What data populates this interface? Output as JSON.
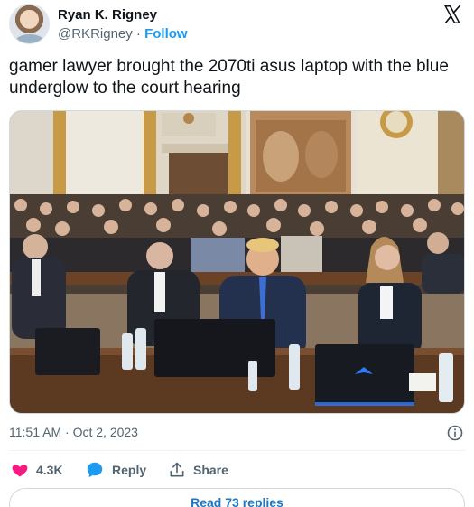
{
  "author": {
    "name": "Ryan K. Rigney",
    "handle": "@RKRigney",
    "separator": " · ",
    "follow_label": "Follow"
  },
  "brand": {
    "icon": "x-logo-icon"
  },
  "tweet": {
    "text": "gamer lawyer brought the 2070ti asus laptop with the blue underglow to the court hearing"
  },
  "media": {
    "type": "photo",
    "icon": "courtroom-photo"
  },
  "meta": {
    "time": "11:51 AM",
    "dot": " · ",
    "date": "Oct 2, 2023",
    "info_icon": "info-icon"
  },
  "actions": {
    "likes": "4.3K",
    "reply_label": "Reply",
    "share_label": "Share",
    "like_icon": "heart-icon",
    "reply_icon": "speech-bubble-icon",
    "share_icon": "share-icon"
  },
  "footer": {
    "read_replies": "Read 73 replies"
  },
  "colors": {
    "accent": "#1d9bf0",
    "like": "#f91880",
    "text": "#0f1419",
    "secondary": "#536471",
    "laptop_glow": "#2b7bff"
  }
}
